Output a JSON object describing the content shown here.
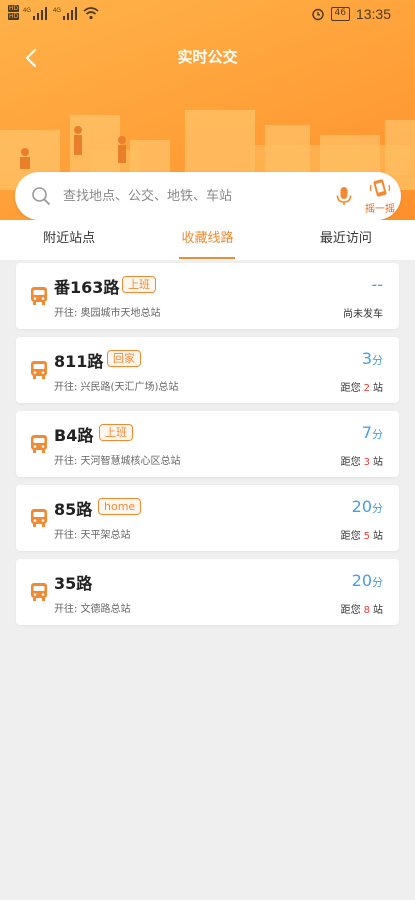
{
  "status_bar": {
    "hd1": "HD",
    "hd2": "HD",
    "net1": "4G",
    "net2": "4G",
    "battery": "46",
    "time": "13:35"
  },
  "header": {
    "title": "实时公交"
  },
  "search": {
    "placeholder": "查找地点、公交、地铁、车站",
    "shake_label": "摇一摇"
  },
  "tabs": [
    {
      "label": "附近站点",
      "active": false
    },
    {
      "label": "收藏线路",
      "active": true
    },
    {
      "label": "最近访问",
      "active": false
    }
  ],
  "routes": [
    {
      "name": "番163路",
      "tag": "上班",
      "dest": "开往: 奥园城市天地总站",
      "eta": "--",
      "eta_unit": "",
      "status": "尚未发车",
      "dist_prefix": "",
      "dist_stops": "",
      "dist_suffix": ""
    },
    {
      "name": "811路",
      "tag": "回家",
      "dest": "开往: 兴民路(天汇广场)总站",
      "eta": "3",
      "eta_unit": "分",
      "status": "",
      "dist_prefix": "距您",
      "dist_stops": "2",
      "dist_suffix": "站"
    },
    {
      "name": "B4路",
      "tag": "上班",
      "dest": "开往: 天河智慧城核心区总站",
      "eta": "7",
      "eta_unit": "分",
      "status": "",
      "dist_prefix": "距您",
      "dist_stops": "3",
      "dist_suffix": "站"
    },
    {
      "name": "85路",
      "tag": "home",
      "dest": "开往: 天平架总站",
      "eta": "20",
      "eta_unit": "分",
      "status": "",
      "dist_prefix": "距您",
      "dist_stops": "5",
      "dist_suffix": "站"
    },
    {
      "name": "35路",
      "tag": "",
      "dest": "开往: 文德路总站",
      "eta": "20",
      "eta_unit": "分",
      "status": "",
      "dist_prefix": "距您",
      "dist_stops": "8",
      "dist_suffix": "站"
    }
  ],
  "colors": {
    "accent": "#f28a34",
    "eta": "#4b9de0",
    "stops": "#e4413a"
  }
}
